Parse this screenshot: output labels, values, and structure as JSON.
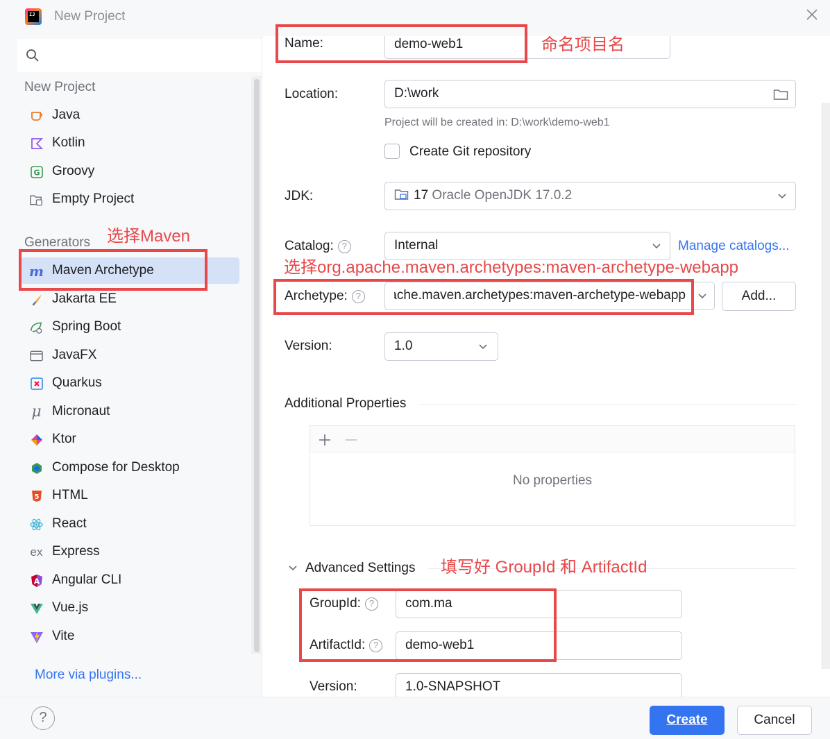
{
  "window": {
    "title": "New Project",
    "app_icon": "intellij-idea-icon",
    "close_icon": "close-icon"
  },
  "sidebar": {
    "search_icon": "search-icon",
    "section_new": "New Project",
    "new_items": [
      {
        "label": "Java",
        "icon": "java-cup-icon"
      },
      {
        "label": "Kotlin",
        "icon": "kotlin-icon"
      },
      {
        "label": "Groovy",
        "icon": "groovy-icon"
      },
      {
        "label": "Empty Project",
        "icon": "empty-project-icon"
      }
    ],
    "section_generators": "Generators",
    "generators": [
      {
        "label": "Maven Archetype",
        "icon": "maven-icon",
        "selected": true
      },
      {
        "label": "Jakarta EE",
        "icon": "jakarta-ee-icon"
      },
      {
        "label": "Spring Boot",
        "icon": "spring-boot-icon"
      },
      {
        "label": "JavaFX",
        "icon": "javafx-icon"
      },
      {
        "label": "Quarkus",
        "icon": "quarkus-icon"
      },
      {
        "label": "Micronaut",
        "icon": "micronaut-icon"
      },
      {
        "label": "Ktor",
        "icon": "ktor-icon"
      },
      {
        "label": "Compose for Desktop",
        "icon": "compose-icon"
      },
      {
        "label": "HTML",
        "icon": "html5-icon"
      },
      {
        "label": "React",
        "icon": "react-icon"
      },
      {
        "label": "Express",
        "icon": "express-icon"
      },
      {
        "label": "Angular CLI",
        "icon": "angular-icon"
      },
      {
        "label": "Vue.js",
        "icon": "vue-icon"
      },
      {
        "label": "Vite",
        "icon": "vite-icon"
      }
    ],
    "more_link": "More via plugins..."
  },
  "form": {
    "name_label": "Name:",
    "name_value": "demo-web1",
    "location_label": "Location:",
    "location_value": "D:\\work",
    "location_hint": "Project will be created in: D:\\work\\demo-web1",
    "git_label": "Create Git repository",
    "git_checked": false,
    "jdk_label": "JDK:",
    "jdk_version": "17",
    "jdk_name": "Oracle OpenJDK 17.0.2",
    "catalog_label": "Catalog:",
    "catalog_value": "Internal",
    "manage_catalogs": "Manage catalogs...",
    "archetype_label": "Archetype:",
    "archetype_value": "org.apache.maven.archetypes:maven-archetype-webapp",
    "add_button": "Add...",
    "version_label": "Version:",
    "version_value": "1.0",
    "additional_props": "Additional Properties",
    "no_props": "No properties",
    "advanced_settings": "Advanced Settings",
    "groupid_label": "GroupId:",
    "groupid_value": "com.ma",
    "artifactid_label": "ArtifactId:",
    "artifactid_value": "demo-web1",
    "adv_version_label": "Version:",
    "adv_version_value": "1.0-SNAPSHOT"
  },
  "footer": {
    "create": "Create",
    "cancel": "Cancel",
    "help": "?"
  },
  "annotations": {
    "name_note": "命名项目名",
    "maven_note": "选择Maven",
    "archetype_note": "选择org.apache.maven.archetypes:maven-archetype-webapp",
    "group_note": "填写好 GroupId 和 ArtifactId",
    "color": "#e8484a"
  },
  "colors": {
    "accent": "#3574f0",
    "selected_bg": "#d5e1f7",
    "annotation": "#e8484a"
  }
}
